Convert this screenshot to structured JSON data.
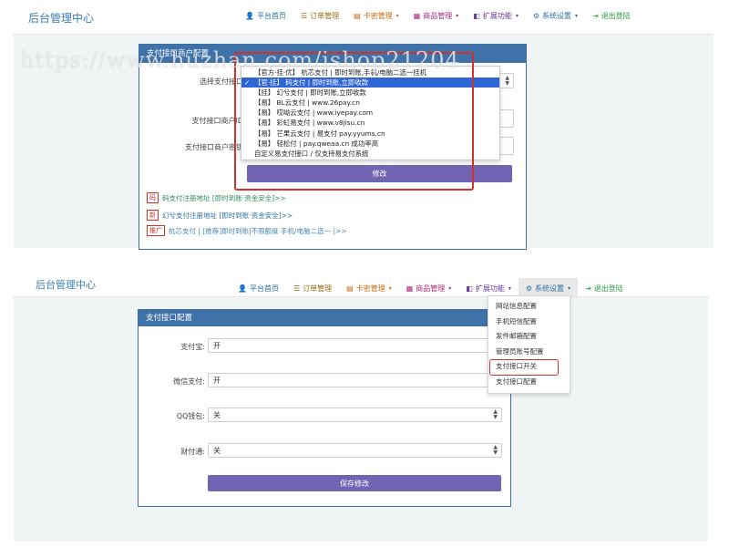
{
  "colors": {
    "brand": "#3a7fb4",
    "panel_header": "#3f72a8",
    "button": "#7263b3",
    "highlight_red": "#d0332e",
    "select_blue": "#2f66d6"
  },
  "top": {
    "brand": "后台管理中心",
    "nav": [
      {
        "label": "平台首页",
        "icon": "user-icon",
        "color": "#2c6fa3"
      },
      {
        "label": "订单管理",
        "icon": "list-icon",
        "color": "#9a6a12"
      },
      {
        "label": "卡密管理",
        "icon": "card-icon",
        "color": "#c86b12",
        "dropdown": true
      },
      {
        "label": "商品管理",
        "icon": "goods-icon",
        "color": "#b0277e",
        "dropdown": true
      },
      {
        "label": "扩展功能",
        "icon": "extend-icon",
        "color": "#6a3a9a",
        "dropdown": true
      },
      {
        "label": "系统设置",
        "icon": "gear-icon",
        "color": "#2c6fa3",
        "dropdown": true
      },
      {
        "label": "退出登陆",
        "icon": "logout-icon",
        "color": "#2a9a43"
      }
    ],
    "watermark": "https://www.huzhan.com/ishop21204",
    "panel_title": "支付接口商户配置",
    "fields": {
      "select_label": "选择支付接口",
      "merchant_id_label": "支付接口商户ID",
      "merchant_key_label": "支付接口商户密钥"
    },
    "dropdown_options": [
      "【官方·挂·优】 杭芯支付 | 即时到账,手机/电脑二选一挂机",
      "【官·挂】 码支付 | 即时到账,立即收款",
      "【挂】 幻兮支付 | 即时到账,立即收款",
      "【易】 BL云支付 | www.26pay.cn",
      "【易】 哎呦云支付 | www.iyepay.com",
      "【易】 彩虹易支付 | www.v8jisu.cn",
      "【易】 芒果云支付 | 易支付 pay.yyums.cn",
      "【易】 轻松付 | pay.qweaa.cn 成功率高",
      "自定义易支付接口 / 仅支持易支付系统"
    ],
    "selected_index": 1,
    "modify_button": "修改",
    "links": [
      {
        "tag": "码",
        "text": "码支付注册地址 [即时到账·资金安全]>>"
      },
      {
        "tag": "新",
        "text": "幻兮支付注册地址 [即时到账·资金安全]>>"
      },
      {
        "tag": "推广",
        "text": "杭芯支付 | [推荐]即时到账|不限额度 手机/电脑二选一 |>>"
      }
    ]
  },
  "bottom": {
    "brand": "后台管理中心",
    "nav": [
      {
        "label": "平台首页",
        "icon": "user-icon",
        "color": "#2c6fa3"
      },
      {
        "label": "订单管理",
        "icon": "list-icon",
        "color": "#9a6a12"
      },
      {
        "label": "卡密管理",
        "icon": "card-icon",
        "color": "#c86b12",
        "dropdown": true
      },
      {
        "label": "商品管理",
        "icon": "goods-icon",
        "color": "#b0277e",
        "dropdown": true
      },
      {
        "label": "扩展功能",
        "icon": "extend-icon",
        "color": "#6a3a9a",
        "dropdown": true
      },
      {
        "label": "系统设置",
        "icon": "gear-icon",
        "color": "#2c6fa3",
        "dropdown": true
      },
      {
        "label": "退出登陆",
        "icon": "logout-icon",
        "color": "#2a9a43"
      }
    ],
    "menu_items": [
      "网站信息配置",
      "手机短信配置",
      "发件邮箱配置",
      "管理员账号配置",
      "支付接口开关",
      "支付接口配置"
    ],
    "menu_highlight_index": 4,
    "panel_title": "支付接口配置",
    "fields": [
      {
        "label": "支付宝:",
        "value": "开",
        "type": "text"
      },
      {
        "label": "微信支付:",
        "value": "开",
        "type": "text"
      },
      {
        "label": "QQ钱包:",
        "value": "关",
        "type": "select"
      },
      {
        "label": "财付通:",
        "value": "关",
        "type": "select"
      }
    ],
    "save_button": "保存修改"
  }
}
